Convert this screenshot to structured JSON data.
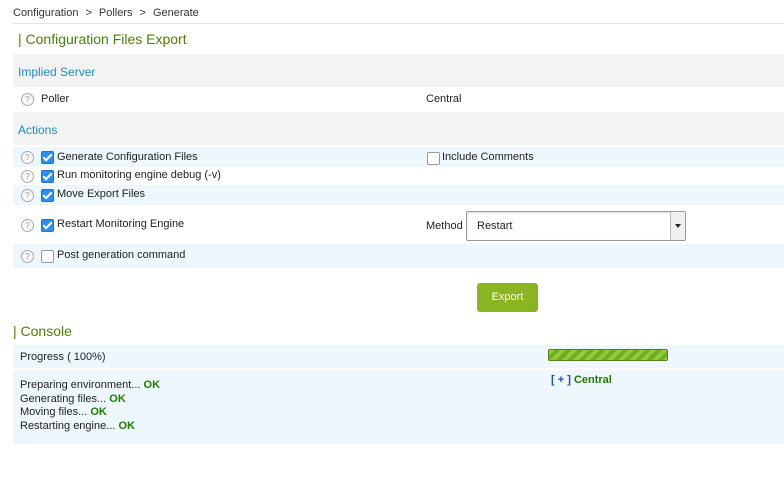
{
  "breadcrumb": {
    "items": [
      "Configuration",
      "Pollers",
      "Generate"
    ],
    "sep": ">"
  },
  "header": {
    "title": "| Configuration Files Export"
  },
  "implied": {
    "title": "Implied Server",
    "poller_label": "Poller",
    "poller_value": "Central"
  },
  "actions": {
    "title": "Actions",
    "generate": {
      "label": "Generate Configuration Files",
      "checked": true
    },
    "include_comments": {
      "label": "Include Comments",
      "checked": false
    },
    "debug": {
      "label": "Run monitoring engine debug (-v)",
      "checked": true
    },
    "move": {
      "label": "Move Export Files",
      "checked": true
    },
    "restart": {
      "label": "Restart Monitoring Engine",
      "checked": true
    },
    "method_label": "Method",
    "method_value": "Restart",
    "post": {
      "label": "Post generation command",
      "checked": false
    }
  },
  "export_button": "Export",
  "console": {
    "title": "| Console",
    "progress_label": "Progress ( 100%)",
    "progress": 1.0,
    "log": [
      {
        "text": "Preparing environment...",
        "status": "OK"
      },
      {
        "text": "Generating files...",
        "status": "OK"
      },
      {
        "text": "Moving files...",
        "status": "OK"
      },
      {
        "text": "Restarting engine...",
        "status": "OK"
      }
    ],
    "poller_toggle": "[ + ]",
    "poller_name": "Central"
  },
  "colors": {
    "accent_green": "#4f7d0a",
    "link_blue": "#1a8ec8",
    "button": "#8ab521"
  }
}
